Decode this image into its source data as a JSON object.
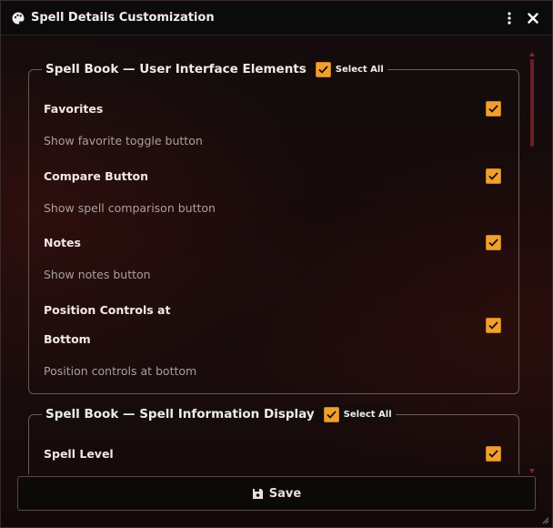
{
  "window": {
    "title": "Spell Details Customization",
    "icons": {
      "app": "palette-icon",
      "menu": "kebab-menu-icon",
      "close": "close-icon"
    }
  },
  "sections": [
    {
      "title": "Spell Book — User Interface Elements",
      "select_all_label": "Select All",
      "select_all_checked": true,
      "items": [
        {
          "label": "Favorites",
          "description": "Show favorite toggle button",
          "checked": true
        },
        {
          "label": "Compare Button",
          "description": "Show spell comparison button",
          "checked": true
        },
        {
          "label": "Notes",
          "description": "Show notes button",
          "checked": true
        },
        {
          "label_line1": "Position Controls at",
          "label_line2": "Bottom",
          "description": "Position controls at bottom",
          "checked": true
        }
      ]
    },
    {
      "title": "Spell Book — Spell Information Display",
      "select_all_label": "Select All",
      "select_all_checked": true,
      "items": [
        {
          "label": "Spell Level",
          "checked": true
        }
      ]
    }
  ],
  "footer": {
    "save_label": "Save",
    "save_icon": "floppy-disk-icon"
  },
  "colors": {
    "accent": "#f0a030",
    "scrollbar": "#6b1e2a",
    "background": "#140a0a"
  }
}
